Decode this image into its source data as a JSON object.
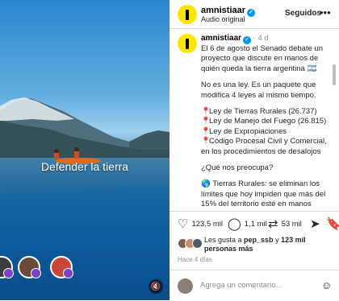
{
  "video": {
    "overlay_text": "Defender la tierra",
    "mute_icon": "mute-icon"
  },
  "header": {
    "username": "amnistiaar",
    "subtitle": "Audio original",
    "follow_label": "Seguidos",
    "more_label": "•••"
  },
  "caption": {
    "username": "amnistiaar",
    "age": "4 d",
    "p1": "El 6 de agosto el Senado debate un proyecto que discute en manos de quién queda la tierra argentina 🇦🇷",
    "p2": "No es una ley. Es un paquete que modifica 4 leyes al mismo tiempo.",
    "items": [
      "Ley de Tierras Rurales (26.737)",
      "Ley de Manejo del Fuego (26.815)",
      "Ley de Expropiaciones",
      "Código Procesal Civil y Comercial, en los procedimientos de desalojos"
    ],
    "question": "¿Qué nos preocupa?",
    "p4": "Tierras Rurales: se eliminan los límites que hoy impiden que más del 15% del territorio esté en manos"
  },
  "actions": {
    "likes": "123,5 mil",
    "comments": "1,1 mil",
    "reposts": "53 mil"
  },
  "likes": {
    "prefix": "Les gusta a ",
    "user": "pep_ssb",
    "middle": " y ",
    "count": "123 mil personas más"
  },
  "date": "Hace 4 días",
  "comment": {
    "placeholder": "Agrega un comentario..."
  },
  "colors": {
    "brand_yellow": "#ffe600",
    "verified_blue": "#0095f6",
    "story_ring_purple": "#7a42c9"
  }
}
